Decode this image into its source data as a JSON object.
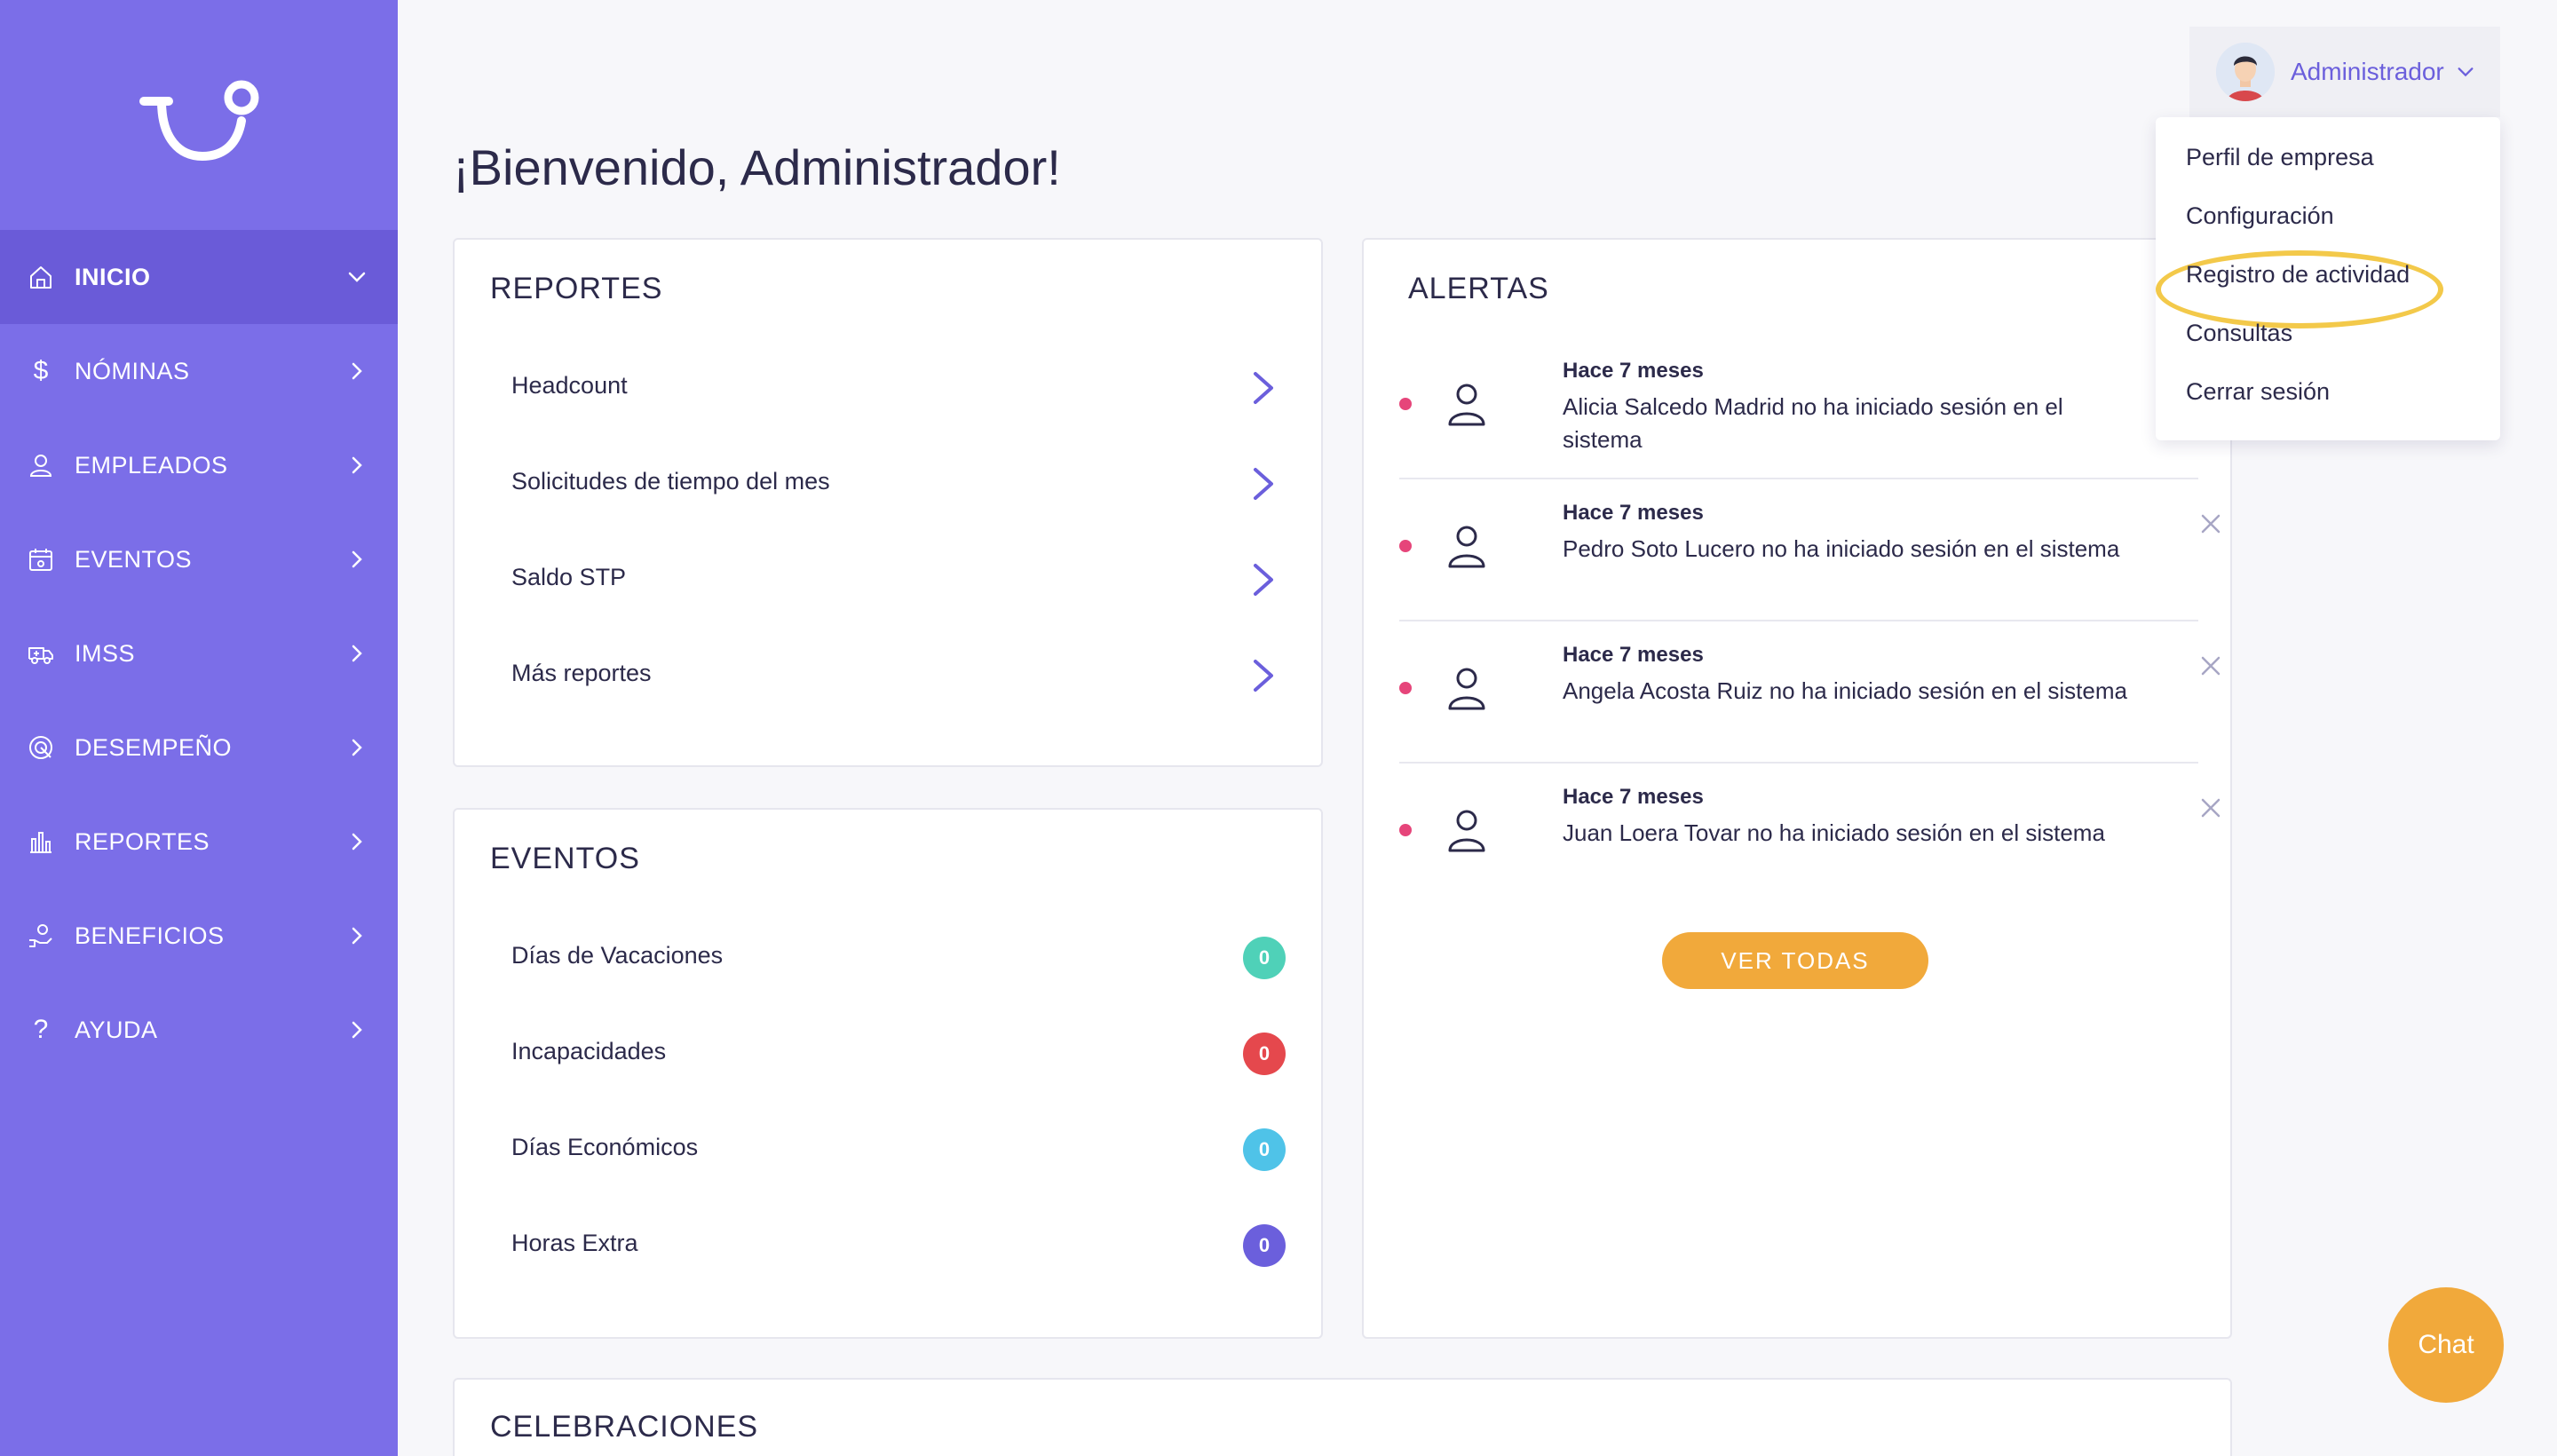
{
  "sidebar": {
    "logo": "tu-logo",
    "items": [
      {
        "label": "INICIO",
        "icon": "home-icon",
        "active": true
      },
      {
        "label": "NÓMINAS",
        "icon": "dollar-icon"
      },
      {
        "label": "EMPLEADOS",
        "icon": "user-icon"
      },
      {
        "label": "EVENTOS",
        "icon": "calendar-icon"
      },
      {
        "label": "IMSS",
        "icon": "ambulance-icon"
      },
      {
        "label": "DESEMPEÑO",
        "icon": "target-icon"
      },
      {
        "label": "REPORTES",
        "icon": "bar-chart-icon"
      },
      {
        "label": "BENEFICIOS",
        "icon": "gift-icon"
      },
      {
        "label": "AYUDA",
        "icon": "question-icon"
      }
    ]
  },
  "header": {
    "welcome": "¡Bienvenido, Administrador!",
    "user_name": "Administrador"
  },
  "user_menu": {
    "items": [
      "Perfil de empresa",
      "Configuración",
      "Registro de actividad",
      "Consultas",
      "Cerrar sesión"
    ],
    "highlighted": "Registro de actividad"
  },
  "reportes": {
    "title": "REPORTES",
    "items": [
      "Headcount",
      "Solicitudes de tiempo del mes",
      "Saldo STP",
      "Más reportes"
    ]
  },
  "eventos": {
    "title": "EVENTOS",
    "items": [
      {
        "label": "Días de Vacaciones",
        "count": "0",
        "color": "#4fd1b8"
      },
      {
        "label": "Incapacidades",
        "count": "0",
        "color": "#e5484d"
      },
      {
        "label": "Días Económicos",
        "count": "0",
        "color": "#4fc3e8"
      },
      {
        "label": "Horas Extra",
        "count": "0",
        "color": "#6b5fdc"
      }
    ]
  },
  "alertas": {
    "title": "ALERTAS",
    "items": [
      {
        "time": "Hace 7 meses",
        "message": "Alicia Salcedo Madrid no ha iniciado sesión en el sistema"
      },
      {
        "time": "Hace 7 meses",
        "message": "Pedro Soto Lucero no ha iniciado sesión en el sistema"
      },
      {
        "time": "Hace 7 meses",
        "message": "Angela Acosta Ruiz no ha iniciado sesión en el sistema"
      },
      {
        "time": "Hace 7 meses",
        "message": "Juan Loera Tovar no ha iniciado sesión en el sistema"
      }
    ],
    "view_all": "VER TODAS"
  },
  "celebraciones": {
    "title": "CELEBRACIONES"
  },
  "chat": {
    "label": "Chat"
  },
  "colors": {
    "sidebar": "#7b6ee8",
    "sidebar_active": "#6a5bd8",
    "accent": "#6b5fdc",
    "button": "#f1a93b",
    "highlight_ring": "#f3c94a",
    "alert_dot": "#e6457a"
  }
}
